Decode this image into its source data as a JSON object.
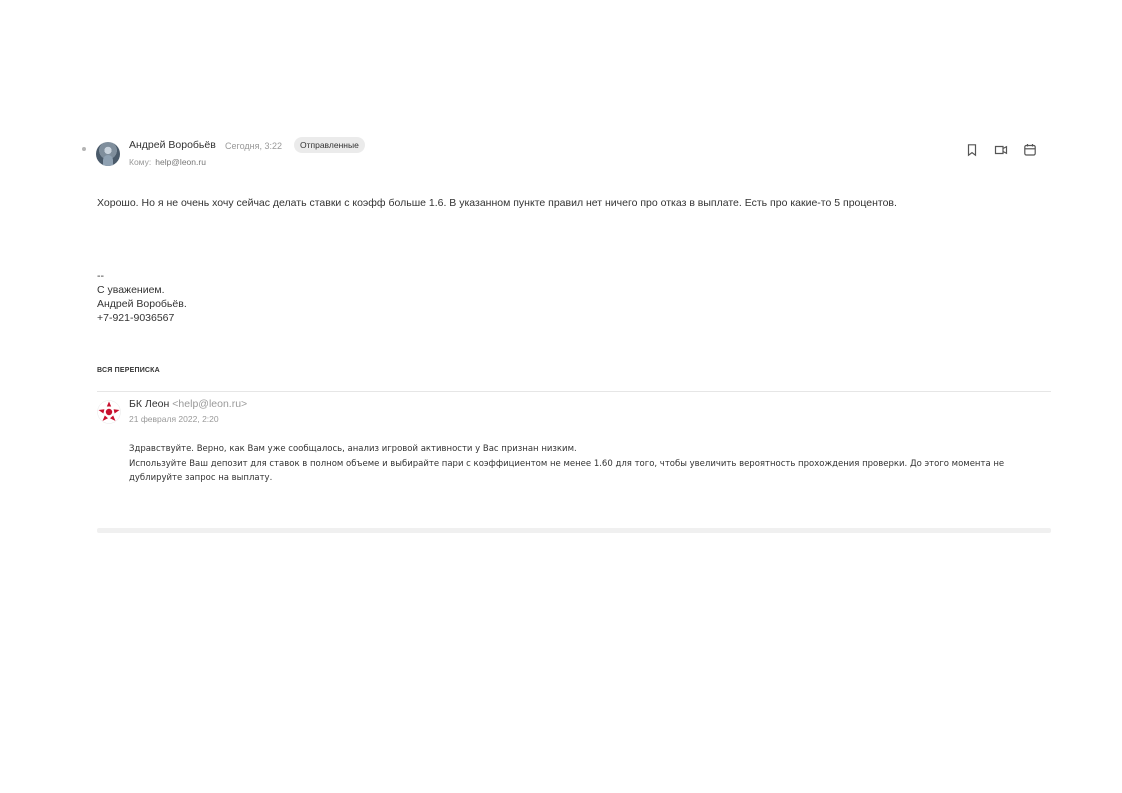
{
  "message": {
    "sender_name": "Андрей Воробьёв",
    "sent_time": "Сегодня, 3:22",
    "folder_badge": "Отправленные",
    "to_label": "Кому:",
    "to_address": "help@leon.ru",
    "body": "Хорошо. Но я не очень хочу сейчас делать ставки с коэфф больше 1.6. В указанном пункте правил нет ничего про отказ в выплате. Есть про какие-то 5 процентов.",
    "signature": {
      "separator": "--",
      "greeting": "С уважением.",
      "name": "Андрей Воробьёв.",
      "phone": "+7-921-9036567"
    }
  },
  "toolbar": {
    "icons": [
      "bookmark-icon",
      "move-to-folder-icon",
      "calendar-icon"
    ]
  },
  "thread": {
    "heading": "ВСЯ ПЕРЕПИСКА",
    "quoted": {
      "sender_name": "БК Леон",
      "sender_address": "<help@leon.ru>",
      "date": "21 февраля 2022, 2:20",
      "lines": [
        "Здравствуйте. Верно, как Вам уже сообщалось, анализ игровой активности у Вас признан низким.",
        "Используйте Ваш депозит для ставок в полном объеме и выбирайте пари с коэффициентом не менее 1.60 для того, чтобы увеличить вероятность прохождения проверки. До этого момента не дублируйте запрос на выплату."
      ]
    }
  },
  "colors": {
    "text": "#333333",
    "muted": "#999999",
    "badge_bg": "#ebebeb",
    "divider": "#e6e6e6",
    "logo_red": "#c8102e"
  }
}
